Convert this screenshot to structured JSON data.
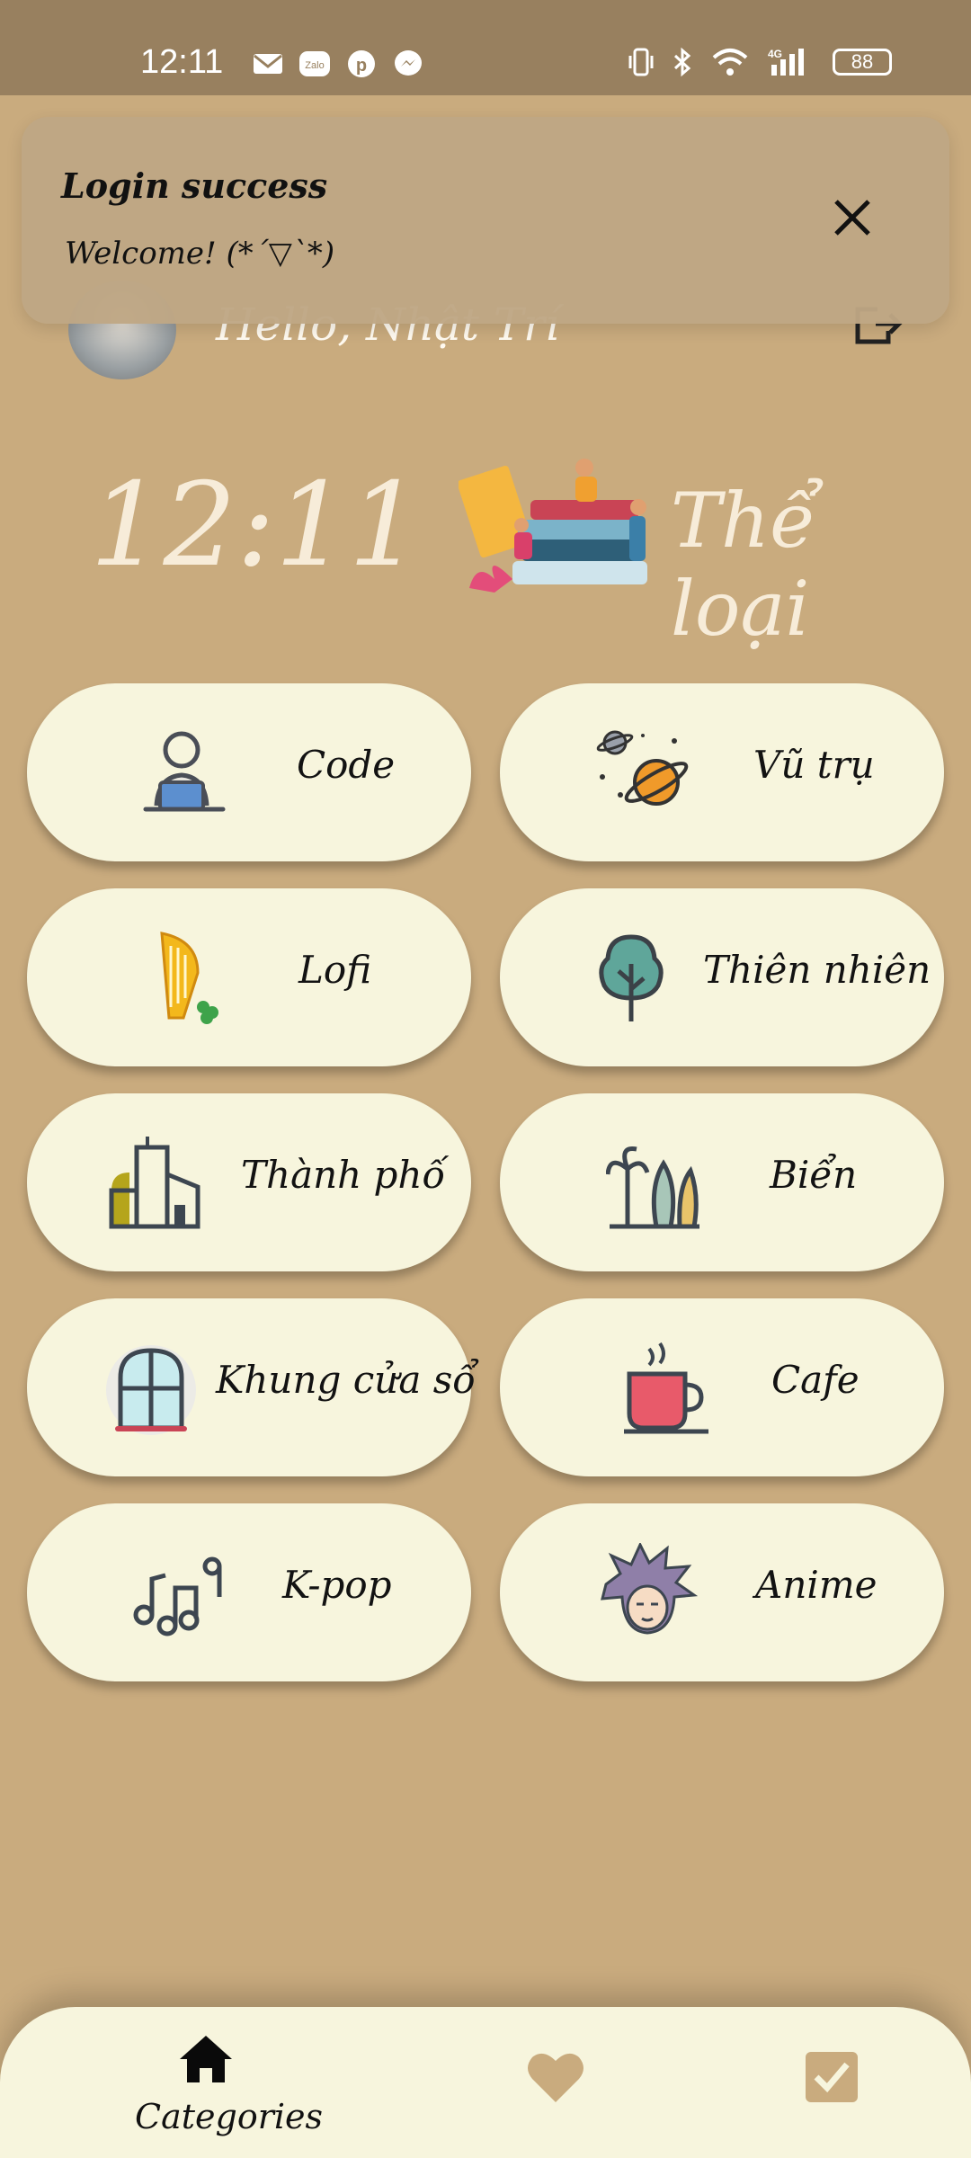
{
  "status_bar": {
    "time": "12:11",
    "battery": "88"
  },
  "toast": {
    "title": "Login success",
    "message": "Welcome! (*´▽`*)"
  },
  "header": {
    "greeting": "Hello, Nhật Trí"
  },
  "clock": "12:11",
  "section_title": "Thể loại",
  "categories": [
    {
      "label": "Code",
      "icon": "coder-laptop-icon"
    },
    {
      "label": "Vũ trụ",
      "icon": "planet-icon"
    },
    {
      "label": "Lofi",
      "icon": "harp-icon"
    },
    {
      "label": "Thiên nhiên",
      "icon": "tree-icon"
    },
    {
      "label": "Thành phố",
      "icon": "city-icon"
    },
    {
      "label": "Biển",
      "icon": "palm-tree-icon"
    },
    {
      "label": "Khung cửa sổ",
      "icon": "window-icon"
    },
    {
      "label": "Cafe",
      "icon": "coffee-cup-icon"
    },
    {
      "label": "K-pop",
      "icon": "music-notes-icon"
    },
    {
      "label": "Anime",
      "icon": "anime-face-icon"
    }
  ],
  "bottom_nav": {
    "active_label": "Categories"
  },
  "colors": {
    "background": "#c9ab7e",
    "card": "#f7f5dd",
    "status_bar": "#98805f",
    "icon_brown": "#c9ab7e"
  }
}
